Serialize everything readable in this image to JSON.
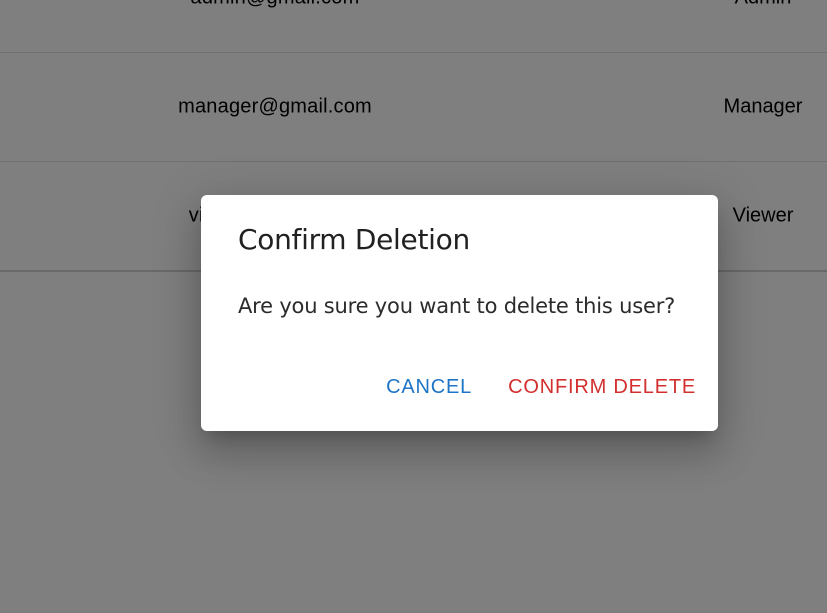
{
  "users_table": {
    "rows": [
      {
        "email": "admin@gmail.com",
        "role": "Admin"
      },
      {
        "email": "manager@gmail.com",
        "role": "Manager"
      },
      {
        "email": "viewer@gmail.com",
        "role": "Viewer"
      }
    ]
  },
  "dialog": {
    "title": "Confirm Deletion",
    "message": "Are you sure you want to delete this user?",
    "cancel_label": "CANCEL",
    "confirm_label": "CONFIRM DELETE"
  },
  "colors": {
    "cancel": "#1e74c7",
    "confirm": "#d32f2f",
    "backdrop": "rgba(0,0,0,0.5)"
  }
}
